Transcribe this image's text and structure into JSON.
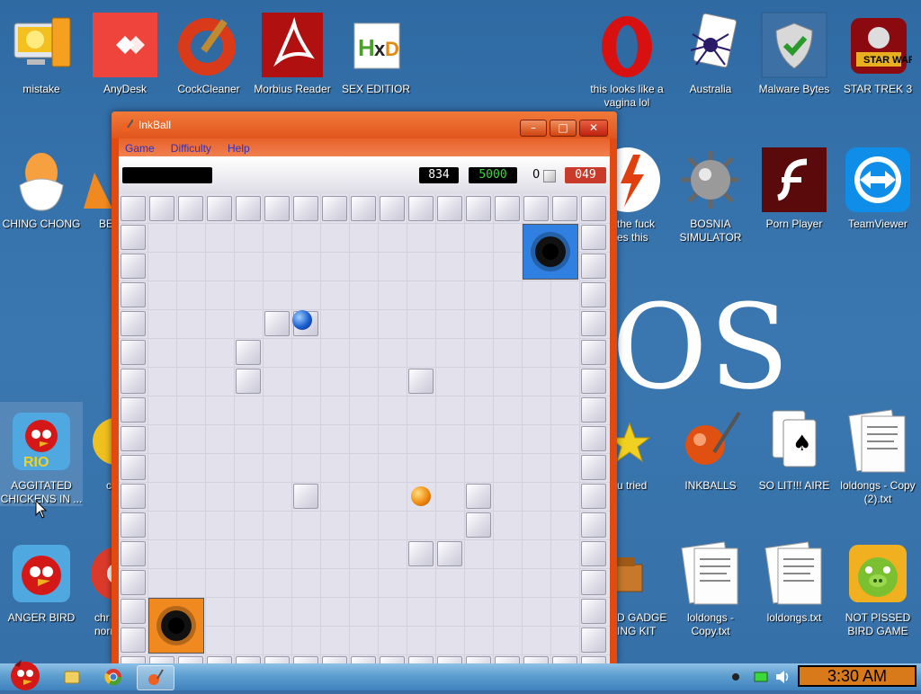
{
  "desktop": {
    "watermark": "OS",
    "icons": {
      "mistake": "mistake",
      "anydesk": "AnyDesk",
      "cockcleaner": "CockCleaner",
      "morbius": "Morbius Reader",
      "sexeditior": "SEX EDITIOR",
      "opera": "this looks like a vagina lol",
      "australia": "Australia",
      "malware": "Malware Bytes",
      "startrek": "STAR TREK 3",
      "chingchong": "CHING CHONG",
      "be": "BE",
      "thefuck": "the fuck\nes this",
      "bosnia": "BOSNIA SIMULATOR",
      "pornplayer": "Porn Player",
      "teamviewer": "TeamViewer",
      "agitated": "AGGITATED CHICKENS IN ...",
      "c": "c",
      "utried": "u tried",
      "inkballs": "INKBALLS",
      "solit": "SO LIT!!! AIRE",
      "loldongscopy2": "loldongs - Copy (2).txt",
      "angerbird": "ANGER BIRD",
      "chr": "chr\nnorm",
      "gadget": "D GADGET\nING KIT",
      "loldongscopy": "loldongs - Copy.txt",
      "loldongs": "loldongs.txt",
      "notpissed": "NOT PISSED BIRD GAME"
    }
  },
  "window": {
    "title": "InkBall",
    "minimize": "–",
    "maximize": "□",
    "close": "✕",
    "menu": [
      "Game",
      "Difficulty",
      "Help"
    ],
    "scores": {
      "current": "834",
      "target": "5000",
      "lost": "0",
      "time": "049"
    }
  },
  "colors": {
    "window_frame": "#e24a10",
    "blue_hole": "#2f80e0",
    "orange_hole": "#f08a20",
    "clock_bg": "#d87a1a"
  },
  "taskbar": {
    "clock": "3:30 AM"
  }
}
